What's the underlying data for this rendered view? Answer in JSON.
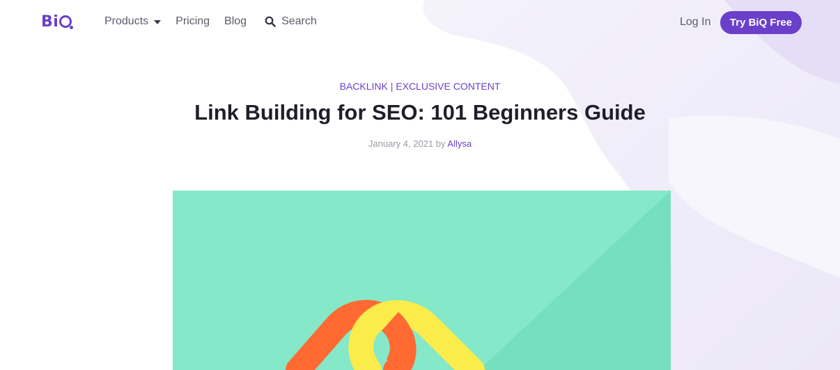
{
  "brand": {
    "name": "BiQ",
    "color": "#6a3fc9"
  },
  "nav": {
    "products": "Products",
    "pricing": "Pricing",
    "blog": "Blog",
    "search": "Search"
  },
  "auth": {
    "login": "Log In",
    "cta": "Try BiQ Free"
  },
  "article": {
    "category_1": "BACKLINK",
    "separator": " | ",
    "category_2": "EXCLUSIVE CONTENT",
    "title": "Link Building for SEO: 101 Beginners Guide",
    "date": "January 4, 2021",
    "by": "by",
    "author": "Allysa"
  },
  "hero": {
    "background": "#84e8c9",
    "chain_colors": [
      "#ff6a33",
      "#f9ec4b"
    ]
  },
  "icons": [
    "chevron-down-icon",
    "search-icon",
    "link-chain-icon"
  ]
}
